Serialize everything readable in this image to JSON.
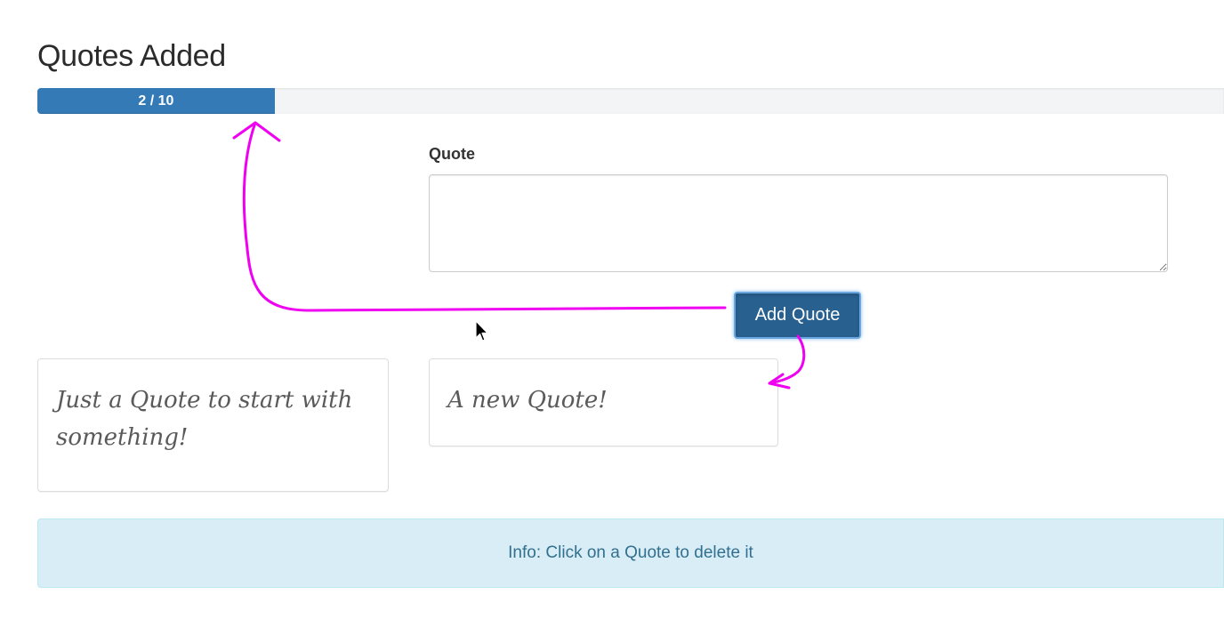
{
  "header": {
    "title": "Quotes Added"
  },
  "progress": {
    "label": "2 / 10",
    "current": 2,
    "max": 10
  },
  "form": {
    "quote_label": "Quote",
    "quote_value": "",
    "add_button_label": "Add Quote"
  },
  "quotes": [
    {
      "text": "Just a Quote to start with something!"
    },
    {
      "text": "A new Quote!"
    }
  ],
  "info": {
    "message": "Info: Click on a Quote to delete it"
  },
  "colors": {
    "primary": "#337ab7",
    "button": "#286090",
    "info_bg": "#d9edf7",
    "info_text": "#31708f",
    "annotation": "#f000f0"
  },
  "icons": {
    "cursor": "mouse-pointer-icon"
  }
}
